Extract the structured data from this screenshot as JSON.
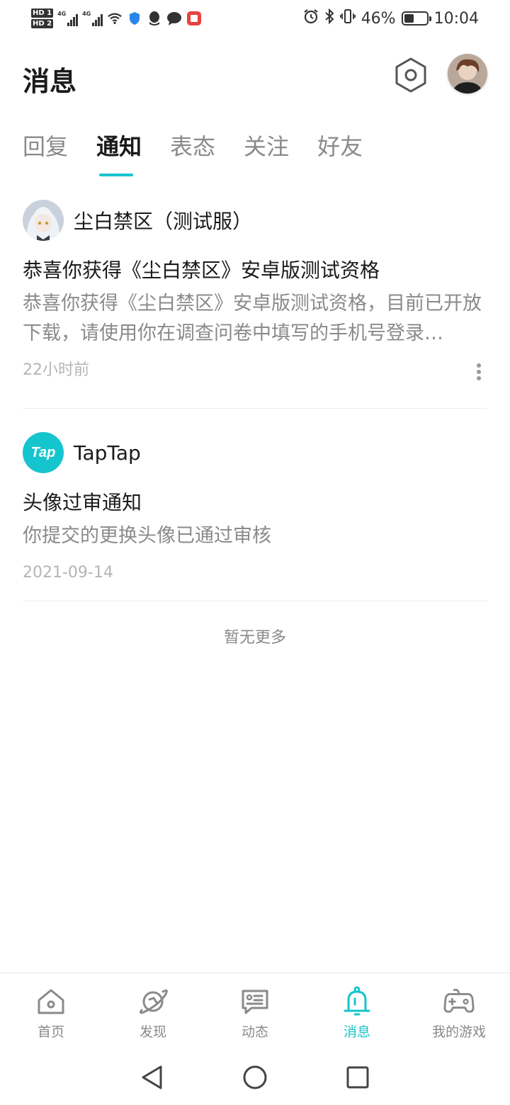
{
  "status_bar": {
    "hd1": "HD 1",
    "hd2": "HD 2",
    "net1": "4G",
    "net2": "4G",
    "battery_text": "46%",
    "battery_level": 0.46,
    "time": "10:04",
    "icons": [
      "wifi-icon",
      "shield-icon",
      "qq-icon",
      "chat-icon",
      "app-icon",
      "alarm-icon",
      "bluetooth-icon",
      "vibrate-icon",
      "battery-icon"
    ]
  },
  "header": {
    "title": "消息",
    "settings_icon": "gear-icon"
  },
  "tabs": [
    {
      "label": "回复",
      "active": false
    },
    {
      "label": "通知",
      "active": true
    },
    {
      "label": "表态",
      "active": false
    },
    {
      "label": "关注",
      "active": false
    },
    {
      "label": "好友",
      "active": false
    }
  ],
  "notifications": [
    {
      "source": "尘白禁区（测试服）",
      "title": "恭喜你获得《尘白禁区》安卓版测试资格",
      "body": "恭喜你获得《尘白禁区》安卓版测试资格，目前已开放下载，请使用你在调查问卷中填写的手机号登录…",
      "time": "22小时前"
    },
    {
      "source": "TapTap",
      "logo_text": "Tap",
      "title": "头像过审通知",
      "body": "你提交的更换头像已通过审核",
      "time": "2021-09-14"
    }
  ],
  "no_more_text": "暂无更多",
  "bottom_nav": [
    {
      "label": "首页",
      "icon": "home-icon",
      "active": false
    },
    {
      "label": "发现",
      "icon": "planet-icon",
      "active": false
    },
    {
      "label": "动态",
      "icon": "feed-icon",
      "active": false
    },
    {
      "label": "消息",
      "icon": "bell-icon",
      "active": true
    },
    {
      "label": "我的游戏",
      "icon": "gamepad-icon",
      "active": false
    }
  ],
  "colors": {
    "accent": "#15c5ce",
    "text_primary": "#1a1a1a",
    "text_secondary": "#8a8a8a",
    "text_muted": "#b5b5b5"
  }
}
